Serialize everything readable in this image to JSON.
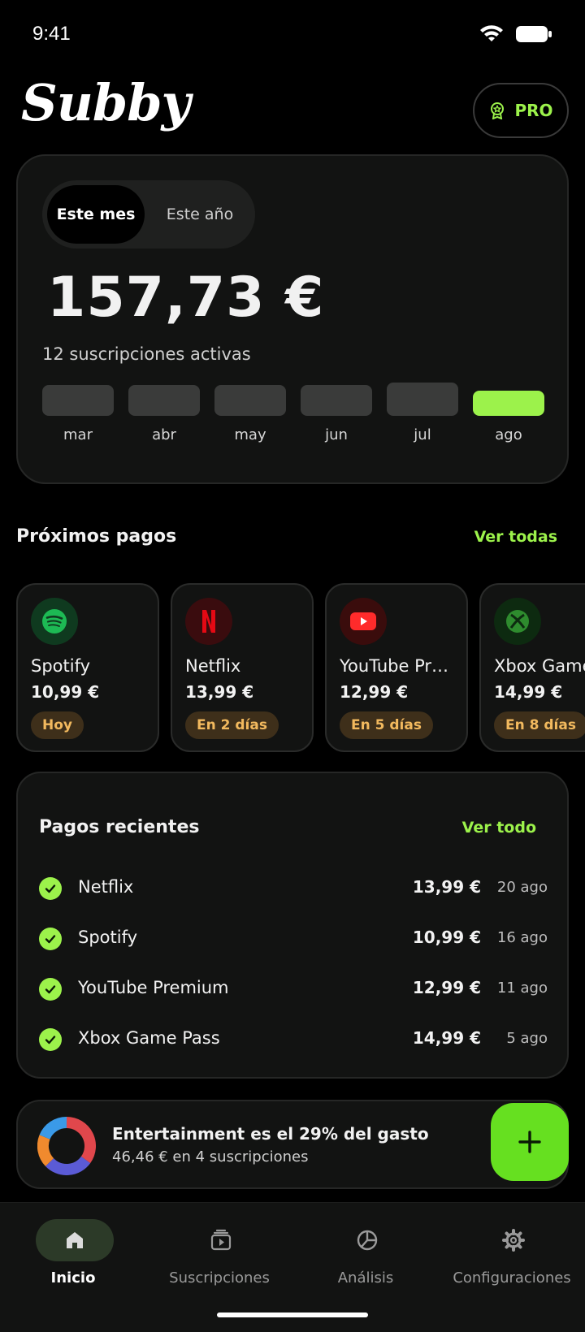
{
  "status": {
    "time": "9:41"
  },
  "header": {
    "logo": "Subby",
    "pro_label": "PRO"
  },
  "summary": {
    "tabs": [
      "Este mes",
      "Este año"
    ],
    "active_tab": "Este mes",
    "total": "157,73 €",
    "active_subscriptions": "12 suscripciones activas",
    "months": [
      {
        "label": "mar",
        "level": 0.56
      },
      {
        "label": "abr",
        "level": 0.56
      },
      {
        "label": "may",
        "level": 0.56
      },
      {
        "label": "jun",
        "level": 0.56
      },
      {
        "label": "jul",
        "level": 0.6
      },
      {
        "label": "ago",
        "level": 0.45
      }
    ],
    "current_month": "ago",
    "accent_color": "#9cf24b"
  },
  "upcoming": {
    "title": "Próximos pagos",
    "link": "Ver todas",
    "items": [
      {
        "name": "Spotify",
        "price": "10,99 €",
        "due": "Hoy",
        "icon": "spotify-icon",
        "color": "#1db954"
      },
      {
        "name": "Netflix",
        "price": "13,99 €",
        "due": "En 2 días",
        "icon": "netflix-icon",
        "color": "#e50914"
      },
      {
        "name": "YouTube Pr…",
        "price": "12,99 €",
        "due": "En 5 días",
        "icon": "youtube-icon",
        "color": "#ff0000"
      },
      {
        "name": "Xbox Game",
        "price": "14,99 €",
        "due": "En 8 días",
        "icon": "xbox-icon",
        "color": "#107c10"
      }
    ]
  },
  "recent": {
    "title": "Pagos recientes",
    "link": "Ver todo",
    "items": [
      {
        "name": "Netflix",
        "amount": "13,99 €",
        "date": "20 ago"
      },
      {
        "name": "Spotify",
        "amount": "10,99 €",
        "date": "16 ago"
      },
      {
        "name": "YouTube Premium",
        "amount": "12,99 €",
        "date": "11 ago"
      },
      {
        "name": "Xbox Game Pass",
        "amount": "14,99 €",
        "date": "5 ago"
      }
    ]
  },
  "insight": {
    "title": "Entertainment es el 29% del gasto",
    "subtitle": "46,46 € en 4 suscripciones",
    "donut_colors": [
      "#e0474c",
      "#5b5bd6",
      "#f08a2e",
      "#3a9ae8"
    ]
  },
  "tabbar": {
    "items": [
      {
        "label": "Inicio",
        "icon": "home-icon"
      },
      {
        "label": "Suscripciones",
        "icon": "subscriptions-icon"
      },
      {
        "label": "Análisis",
        "icon": "analysis-icon"
      },
      {
        "label": "Configuraciones",
        "icon": "settings-icon"
      }
    ],
    "active": "Inicio"
  }
}
